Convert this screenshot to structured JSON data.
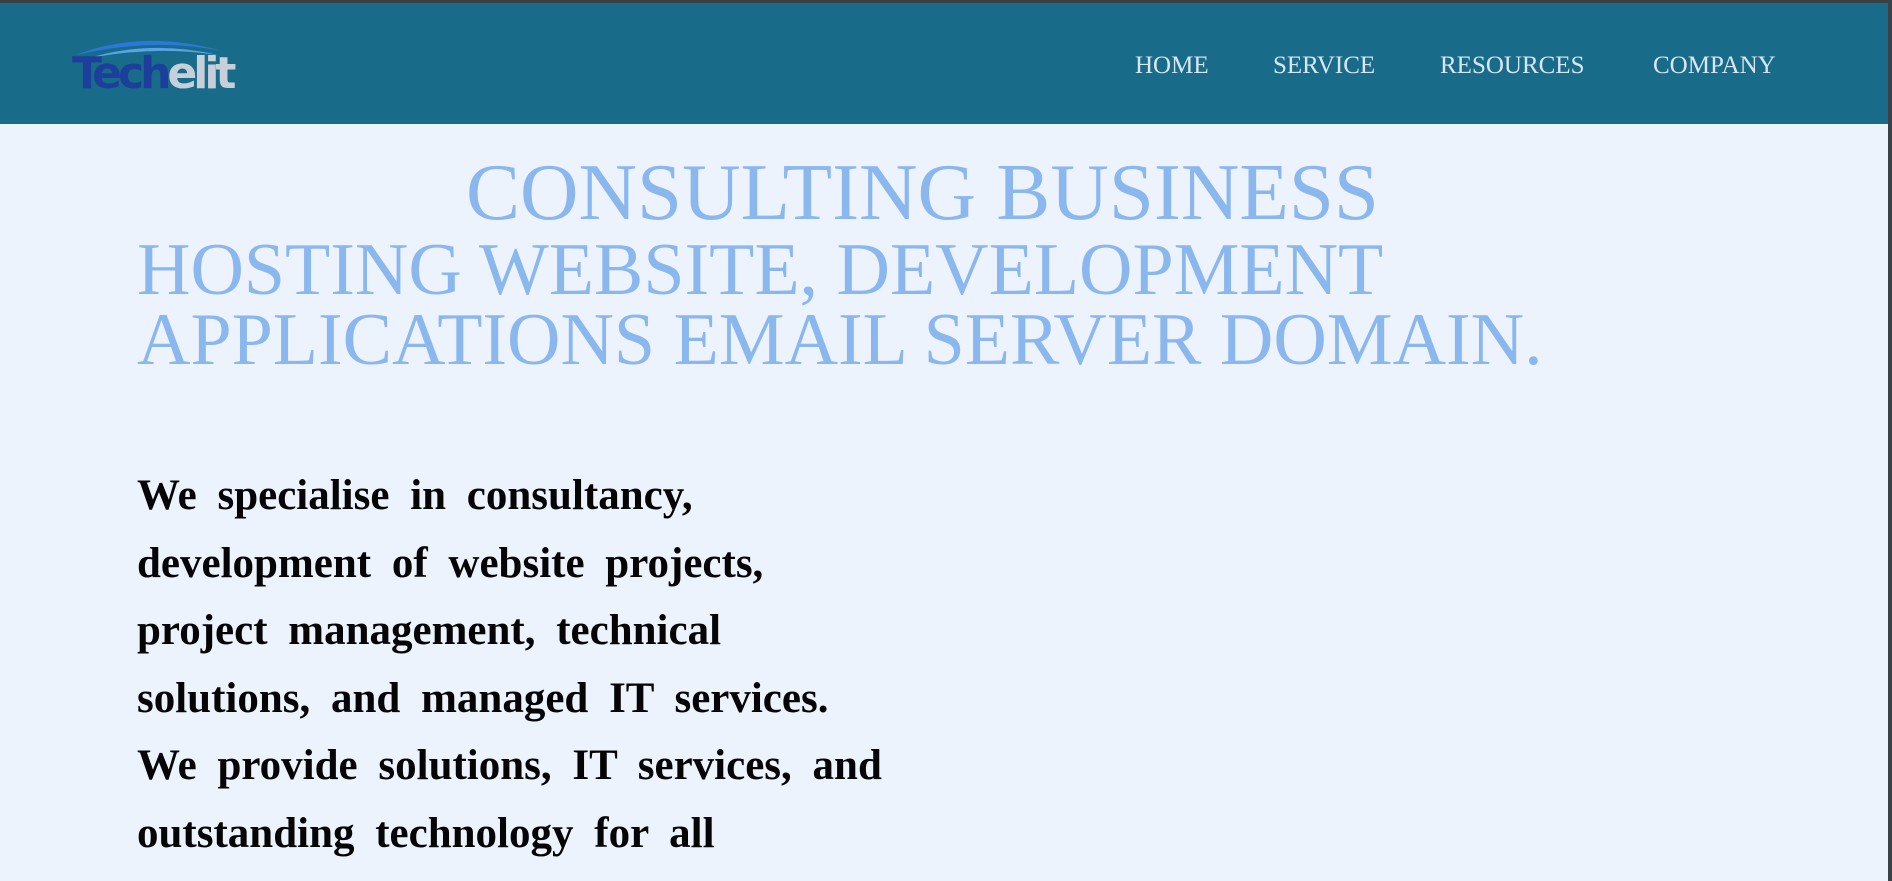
{
  "brand": {
    "logo_part1": "Tech",
    "logo_part2": "elit"
  },
  "nav": {
    "items": [
      {
        "label": "HOME"
      },
      {
        "label": "SERVICE"
      },
      {
        "label": "RESOURCES"
      },
      {
        "label": "COMPANY"
      }
    ]
  },
  "hero": {
    "title": "CONSULTING BUSINESS",
    "subtitle_line1": "HOSTING WEBSITE, DEVELOPMENT",
    "subtitle_line2": "APPLICATIONS EMAIL SERVER DOMAIN."
  },
  "intro": {
    "lines": [
      "We specialise in consultancy,",
      "development of website projects,",
      "project management, technical",
      "solutions, and managed IT services.",
      "We provide solutions, IT services, and",
      "outstanding technology for all"
    ]
  },
  "colors": {
    "navbar": "#196c89",
    "background": "#edf3fd",
    "heading": "#8bb7ef",
    "nav_text": "#d8e6f3",
    "body_text": "#050505"
  }
}
